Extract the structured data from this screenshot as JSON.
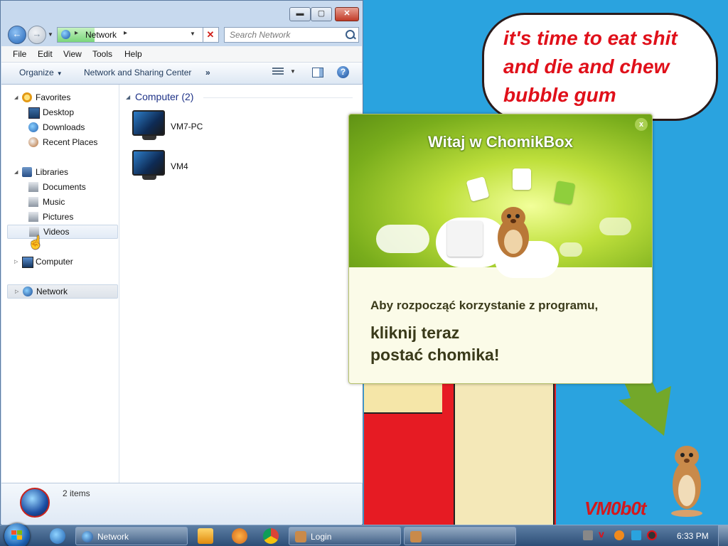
{
  "desktop": {
    "bubble_lines": [
      "it's time to eat shit",
      "and die and chew",
      "bubble gum"
    ],
    "signature": "VM0b0t"
  },
  "explorer": {
    "window_buttons": {
      "minimize": "▬",
      "maximize": "▢",
      "close": "✕"
    },
    "address": {
      "segment": "Network",
      "sep": "▸"
    },
    "search": {
      "placeholder": "Search Network"
    },
    "menu": [
      "File",
      "Edit",
      "View",
      "Tools",
      "Help"
    ],
    "toolbar": {
      "organize": "Organize",
      "network_center": "Network and Sharing Center",
      "more": "»"
    },
    "nav": {
      "favorites": "Favorites",
      "desktop": "Desktop",
      "downloads": "Downloads",
      "recent": "Recent Places",
      "libraries": "Libraries",
      "documents": "Documents",
      "music": "Music",
      "pictures": "Pictures",
      "videos": "Videos",
      "computer": "Computer",
      "network": "Network"
    },
    "content": {
      "group_header": "Computer (2)",
      "computers": [
        "VM7-PC",
        "VM4"
      ]
    },
    "details": {
      "items": "2 items"
    }
  },
  "popup": {
    "title": "Witaj w ChomikBox",
    "close": "x",
    "line1": "Aby rozpocząć korzystanie z programu,",
    "line2a": "kliknij teraz",
    "line2b": "postać chomika!"
  },
  "taskbar": {
    "tasks": [
      "Network",
      "Login"
    ],
    "clock": "6:33 PM"
  },
  "colors": {
    "popup_green": "#8dbd2a",
    "arrow_green": "#7aa81a",
    "wallpaper_blue": "#2aa3df",
    "bubble_red_text": "#e0101a"
  }
}
